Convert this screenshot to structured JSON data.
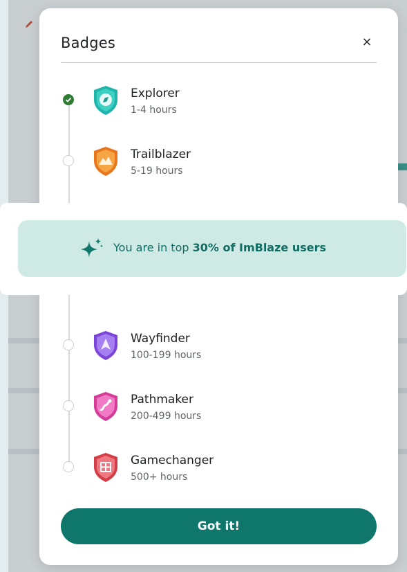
{
  "modal": {
    "title": "Badges",
    "close_label": "×",
    "button_label": "Got it!"
  },
  "badges": [
    {
      "name": "Explorer",
      "hours": "1-4 hours",
      "completed": true,
      "color": "#1fb5ad"
    },
    {
      "name": "Trailblazer",
      "hours": "5-19 hours",
      "completed": false,
      "color": "#f08a24"
    },
    {
      "name": "Wayfinder",
      "hours": "100-199 hours",
      "completed": false,
      "color": "#8e5ce6"
    },
    {
      "name": "Pathmaker",
      "hours": "200-499 hours",
      "completed": false,
      "color": "#e04aa8"
    },
    {
      "name": "Gamechanger",
      "hours": "500+ hours",
      "completed": false,
      "color": "#e0505a"
    }
  ],
  "banner": {
    "prefix": "You are in top ",
    "highlight": "30% of ImBlaze users",
    "icon": "sparkle-icon"
  },
  "colors": {
    "accent": "#0f766b",
    "banner_bg": "#cfe9e5",
    "check_green": "#2e7d32"
  }
}
